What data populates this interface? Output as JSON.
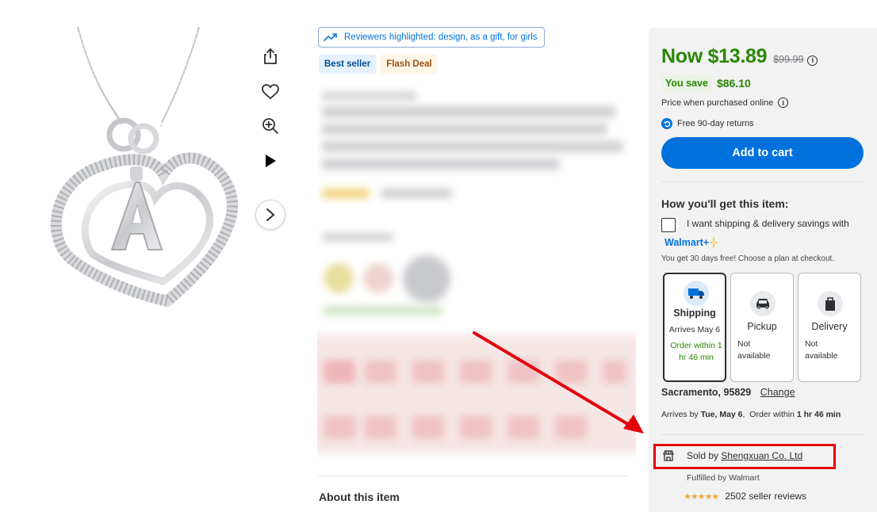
{
  "highlights": {
    "text": "Reviewers highlighted: design, as a gift, for girls"
  },
  "badges": {
    "best_seller": "Best seller",
    "flash_deal": "Flash Deal"
  },
  "about": {
    "title": "About this item"
  },
  "price": {
    "now": "Now $13.89",
    "was": "$99.99",
    "you_save_label": "You save",
    "you_save_amount": "$86.10",
    "price_note": "Price when purchased online",
    "returns": "Free 90-day returns"
  },
  "cart": {
    "add_label": "Add to cart"
  },
  "fulfillment": {
    "heading": "How you'll get this item:",
    "walmart_plus_text": "I want shipping & delivery savings with",
    "walmart_plus_logo": "Walmart+",
    "trial_text": "You get 30 days free! Choose a plan at checkout.",
    "options": [
      {
        "title": "Shipping",
        "sub": "Arrives May 6",
        "note": "Order within 1 hr 46 min"
      },
      {
        "title": "Pickup",
        "na": "Not available"
      },
      {
        "title": "Delivery",
        "na": "Not available"
      }
    ],
    "location": "Sacramento, 95829",
    "change": "Change",
    "arrives_prefix": "Arrives by",
    "arrives_date": "Tue, May 6",
    "order_prefix": "Order within",
    "order_time": "1 hr 46 min"
  },
  "seller": {
    "sold_by": "Sold by",
    "name": "Shengxuan Co. Ltd",
    "fulfilled": "Fulfilled by Walmart",
    "reviews": "2502 seller reviews",
    "stars": "★★★★★"
  },
  "colors": {
    "accent": "#0071dc",
    "green": "#2a8703",
    "annotation": "#e3000b"
  }
}
